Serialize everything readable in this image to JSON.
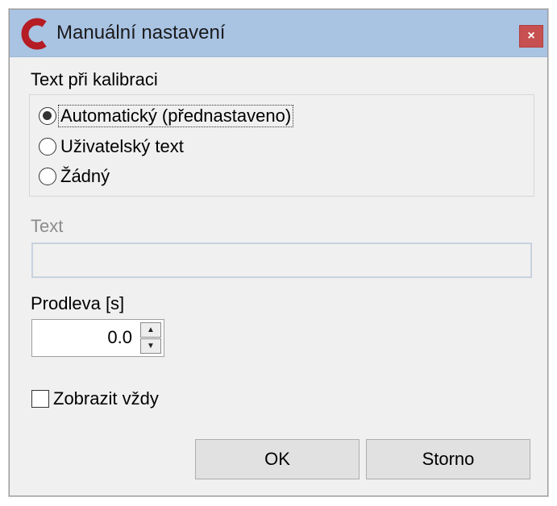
{
  "window": {
    "title": "Manuální nastavení",
    "close_label": "×",
    "accent_color": "#a9c3e3",
    "icon": "app-logo-icon"
  },
  "calibration": {
    "group_label": "Text při kalibraci",
    "options": [
      {
        "label": "Automatický (přednastaveno)",
        "checked": true
      },
      {
        "label": "Uživatelský text",
        "checked": false
      },
      {
        "label": "Žádný",
        "checked": false
      }
    ]
  },
  "text_field": {
    "label": "Text",
    "value": "",
    "disabled": true
  },
  "delay": {
    "label": "Prodleva [s]",
    "value": "0.0"
  },
  "show_always": {
    "label": "Zobrazit vždy",
    "checked": false
  },
  "buttons": {
    "ok": "OK",
    "cancel": "Storno"
  }
}
